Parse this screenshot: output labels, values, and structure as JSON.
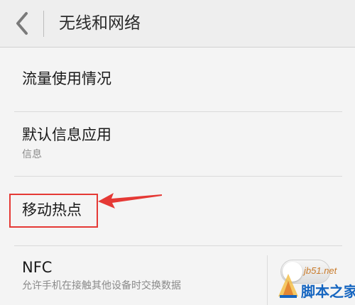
{
  "header": {
    "title": "无线和网络",
    "back_icon": "chevron-left-icon"
  },
  "items": [
    {
      "title": "流量使用情况",
      "subtitle": ""
    },
    {
      "title": "默认信息应用",
      "subtitle": "信息"
    },
    {
      "title": "移动热点",
      "subtitle": ""
    },
    {
      "title": "NFC",
      "subtitle": "允许手机在接触其他设备时交换数据",
      "toggle": "off"
    }
  ],
  "annotation": {
    "highlight_color": "#e53935",
    "arrow_icon": "arrow-left-icon"
  },
  "watermark": {
    "url": "jb51.net",
    "name": "脚本之家",
    "logo_icon": "logo-icon"
  }
}
